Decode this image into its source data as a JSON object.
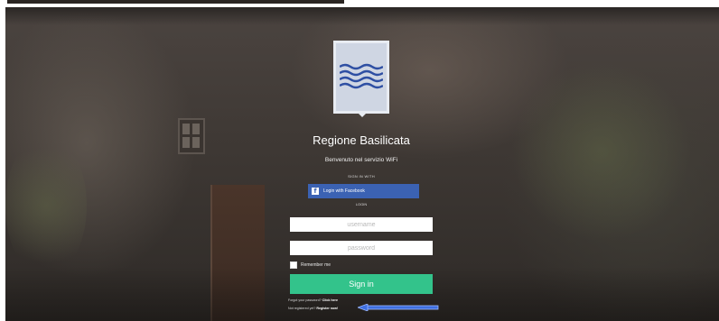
{
  "brand": {
    "title": "Regione Basilicata",
    "subtitle": "Benvenuto nel servizio WiFi",
    "logo_icon": "waves-crest-icon",
    "logo_background": "#cfd6e3",
    "logo_wave_color": "#2e4fa3"
  },
  "social": {
    "section_label": "SIGN IN WITH",
    "facebook_label": "Login with Facebook",
    "facebook_color": "#3b62b3"
  },
  "login": {
    "section_label": "LOGIN",
    "username_placeholder": "username",
    "password_placeholder": "password",
    "remember_label": "Remember me",
    "signin_label": "Sign in",
    "signin_color": "#33c38b"
  },
  "footer": {
    "forgot_text": "Forgot your password?",
    "forgot_link": "Click here",
    "register_text": "Not registered yet?",
    "register_link": "Register now!"
  },
  "annotation": {
    "arrow_color": "#3f6fe0"
  }
}
